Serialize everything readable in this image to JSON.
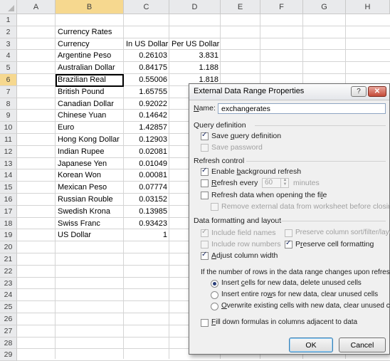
{
  "columns": [
    "A",
    "B",
    "C",
    "D",
    "E",
    "F",
    "G",
    "H"
  ],
  "rows": [
    {
      "num": "1",
      "b": "",
      "c": "",
      "d": ""
    },
    {
      "num": "2",
      "b": "Currency Rates",
      "c": "",
      "d": ""
    },
    {
      "num": "3",
      "b": "Currency",
      "c": "In US Dollar",
      "d": "Per US Dollar"
    },
    {
      "num": "4",
      "b": "Argentine Peso",
      "c": "0.26103",
      "d": "3.831"
    },
    {
      "num": "5",
      "b": "Australian Dollar",
      "c": "0.84175",
      "d": "1.188"
    },
    {
      "num": "6",
      "b": "Brazilian Real",
      "c": "0.55006",
      "d": "1.818"
    },
    {
      "num": "7",
      "b": "British Pound",
      "c": "1.65755",
      "d": ""
    },
    {
      "num": "8",
      "b": "Canadian Dollar",
      "c": "0.92022",
      "d": ""
    },
    {
      "num": "9",
      "b": "Chinese Yuan",
      "c": "0.14642",
      "d": ""
    },
    {
      "num": "10",
      "b": "Euro",
      "c": "1.42857",
      "d": ""
    },
    {
      "num": "11",
      "b": "Hong Kong Dollar",
      "c": "0.12903",
      "d": ""
    },
    {
      "num": "12",
      "b": "Indian Rupee",
      "c": "0.02081",
      "d": ""
    },
    {
      "num": "13",
      "b": "Japanese Yen",
      "c": "0.01049",
      "d": ""
    },
    {
      "num": "14",
      "b": "Korean Won",
      "c": "0.00081",
      "d": ""
    },
    {
      "num": "15",
      "b": "Mexican Peso",
      "c": "0.07774",
      "d": ""
    },
    {
      "num": "16",
      "b": "Russian Rouble",
      "c": "0.03152",
      "d": ""
    },
    {
      "num": "17",
      "b": "Swedish Krona",
      "c": "0.13985",
      "d": ""
    },
    {
      "num": "18",
      "b": "Swiss Franc",
      "c": "0.93423",
      "d": ""
    },
    {
      "num": "19",
      "b": "US Dollar",
      "c": "1",
      "d": ""
    },
    {
      "num": "20",
      "b": "",
      "c": "",
      "d": ""
    },
    {
      "num": "21",
      "b": "",
      "c": "",
      "d": ""
    },
    {
      "num": "22",
      "b": "",
      "c": "",
      "d": ""
    },
    {
      "num": "23",
      "b": "",
      "c": "",
      "d": ""
    },
    {
      "num": "24",
      "b": "",
      "c": "",
      "d": ""
    },
    {
      "num": "25",
      "b": "",
      "c": "",
      "d": ""
    },
    {
      "num": "26",
      "b": "",
      "c": "",
      "d": ""
    },
    {
      "num": "27",
      "b": "",
      "c": "",
      "d": ""
    },
    {
      "num": "28",
      "b": "",
      "c": "",
      "d": ""
    },
    {
      "num": "29",
      "b": "",
      "c": "",
      "d": ""
    }
  ],
  "dialog": {
    "title": "External Data Range Properties",
    "help_icon": "question-mark-icon",
    "close_icon": "close-icon",
    "name_label": "Name:",
    "name_value": "exchangerates",
    "query_def_header": "Query definition",
    "save_query_def": "Save query definition",
    "save_password": "Save password",
    "refresh_header": "Refresh control",
    "enable_bg_refresh": "Enable background refresh",
    "refresh_every": "Refresh every",
    "refresh_minutes_value": "60",
    "minutes_label": "minutes",
    "refresh_on_open": "Refresh data when opening the file",
    "remove_external": "Remove external data from worksheet before closing",
    "format_header": "Data formatting and layout",
    "include_field_names": "Include field names",
    "preserve_sort": "Preserve column sort/filter/layout",
    "include_row_numbers": "Include row numbers",
    "preserve_cell_fmt": "Preserve cell formatting",
    "adjust_col_width": "Adjust column width",
    "rows_change_label": "If the number of rows in the data range changes upon refresh:",
    "radio_insert_cells": "Insert cells for new data, delete unused cells",
    "radio_insert_rows": "Insert entire rows for new data, clear unused cells",
    "radio_overwrite": "Overwrite existing cells with new data, clear unused cells",
    "fill_down": "Fill down formulas in columns adjacent to data",
    "ok_label": "OK",
    "cancel_label": "Cancel"
  }
}
